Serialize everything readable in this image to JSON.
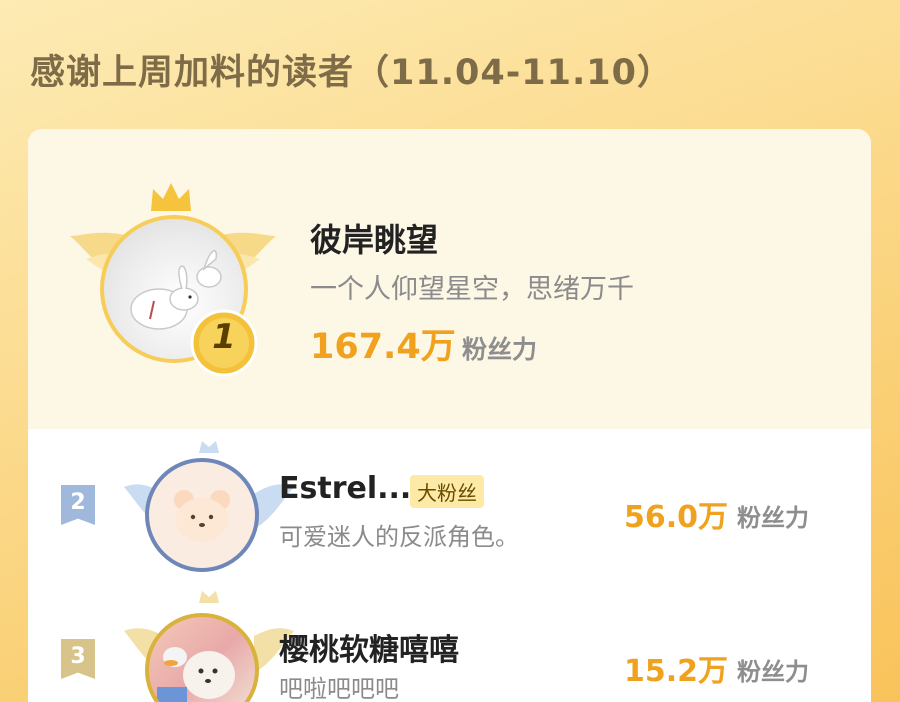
{
  "page": {
    "title": "感谢上周加料的读者（11.04-11.10）"
  },
  "ranking": [
    {
      "rank": "1",
      "name": "彼岸眺望",
      "motto": "一个人仰望星空，思绪万千",
      "score": "167.4万",
      "unit": "粉丝力"
    },
    {
      "rank": "2",
      "name": "Estrel...",
      "tag": "大粉丝",
      "motto": "可爱迷人的反派角色。",
      "score": "56.0万",
      "unit": "粉丝力"
    },
    {
      "rank": "3",
      "name": "樱桃软糖嘻嘻",
      "motto": "吧啦吧吧吧",
      "score": "15.2万",
      "unit": "粉丝力"
    }
  ],
  "colors": {
    "gold": "#f0a21e",
    "badge_silver": "#9fb8dc",
    "badge_bronze": "#d8c48a",
    "background": "#fbd98a"
  },
  "icons": [
    "crown-icon",
    "wings-icon",
    "rank-medal-icon"
  ]
}
